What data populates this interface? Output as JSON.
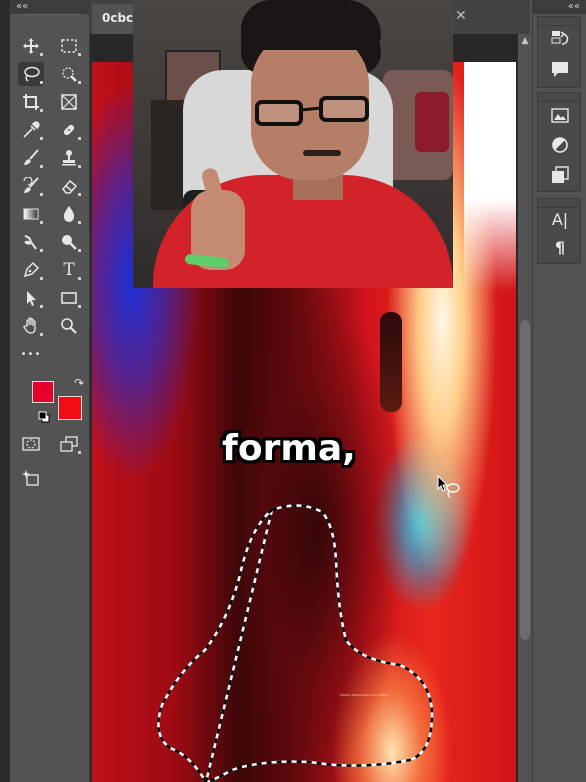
{
  "panels": {
    "left_collapse": "««",
    "right_collapse": "««"
  },
  "document": {
    "tab_title": "0cbce",
    "close_glyph": "✕"
  },
  "tools": [
    {
      "id": "move",
      "icon": "move-icon"
    },
    {
      "id": "marquee",
      "icon": "rectangular-marquee-icon"
    },
    {
      "id": "lasso",
      "icon": "lasso-icon",
      "active": true
    },
    {
      "id": "quick-select",
      "icon": "quick-selection-icon"
    },
    {
      "id": "crop",
      "icon": "crop-icon"
    },
    {
      "id": "frame",
      "icon": "frame-icon"
    },
    {
      "id": "eyedropper",
      "icon": "eyedropper-icon"
    },
    {
      "id": "healing",
      "icon": "healing-brush-icon"
    },
    {
      "id": "brush",
      "icon": "brush-icon"
    },
    {
      "id": "stamp",
      "icon": "clone-stamp-icon"
    },
    {
      "id": "history-brush",
      "icon": "history-brush-icon"
    },
    {
      "id": "eraser",
      "icon": "eraser-icon"
    },
    {
      "id": "gradient",
      "icon": "gradient-icon"
    },
    {
      "id": "blur",
      "icon": "blur-icon"
    },
    {
      "id": "dodge",
      "icon": "dodge-icon"
    },
    {
      "id": "pen",
      "icon": "pen-icon"
    },
    {
      "id": "type",
      "icon": "type-icon",
      "label": "T"
    },
    {
      "id": "path-select",
      "icon": "path-selection-icon"
    },
    {
      "id": "shape",
      "icon": "rectangle-shape-icon"
    },
    {
      "id": "hand",
      "icon": "hand-icon"
    },
    {
      "id": "zoom",
      "icon": "zoom-icon"
    },
    {
      "id": "more",
      "icon": "more-tools-icon",
      "label": "•••"
    }
  ],
  "colors": {
    "foreground": "#e8002c",
    "background": "#f20c14",
    "swap_glyph": "↷"
  },
  "caption": {
    "text": "forma,"
  },
  "poster": {
    "fine_print": "MARCA REGISTRADA DC COMICS"
  },
  "right_panel": [
    {
      "icon": "history-icon"
    },
    {
      "icon": "comments-icon"
    },
    {
      "icon": "libraries-icon"
    },
    {
      "icon": "adjustments-icon"
    },
    {
      "icon": "layers-icon"
    },
    {
      "icon": "character-icon",
      "label": "A|"
    },
    {
      "icon": "paragraph-icon",
      "label": "¶"
    }
  ]
}
